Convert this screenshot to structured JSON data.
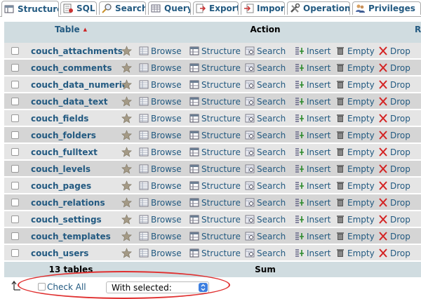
{
  "tabs": [
    {
      "label": "Structure",
      "icon": "structure-icon",
      "active": true
    },
    {
      "label": "SQL",
      "icon": "sql-icon"
    },
    {
      "label": "Search",
      "icon": "search-icon"
    },
    {
      "label": "Query",
      "icon": "query-icon"
    },
    {
      "label": "Export",
      "icon": "export-icon"
    },
    {
      "label": "Import",
      "icon": "import-icon"
    },
    {
      "label": "Operations",
      "icon": "operations-icon"
    },
    {
      "label": "Privileges",
      "icon": "privileges-icon"
    }
  ],
  "header": {
    "table_label": "Table",
    "sort_indicator": "▲",
    "action_label": "Action",
    "extra_col_label": "R"
  },
  "actions": {
    "browse": "Browse",
    "structure": "Structure",
    "search": "Search",
    "insert": "Insert",
    "empty": "Empty",
    "drop": "Drop"
  },
  "rows": [
    {
      "name": "couch_attachments"
    },
    {
      "name": "couch_comments"
    },
    {
      "name": "couch_data_numeric"
    },
    {
      "name": "couch_data_text"
    },
    {
      "name": "couch_fields"
    },
    {
      "name": "couch_folders"
    },
    {
      "name": "couch_fulltext"
    },
    {
      "name": "couch_levels"
    },
    {
      "name": "couch_pages"
    },
    {
      "name": "couch_relations"
    },
    {
      "name": "couch_settings"
    },
    {
      "name": "couch_templates"
    },
    {
      "name": "couch_users"
    }
  ],
  "footer": {
    "count": "13 tables",
    "sum": "Sum"
  },
  "bottom": {
    "check_all": "Check All",
    "with_selected": "With selected:"
  },
  "colors": {
    "link": "#235a81",
    "header_bg": "#d0dce0",
    "row_odd": "#e5e5e5",
    "row_even": "#d5d5d5",
    "annotation": "#e03030"
  }
}
